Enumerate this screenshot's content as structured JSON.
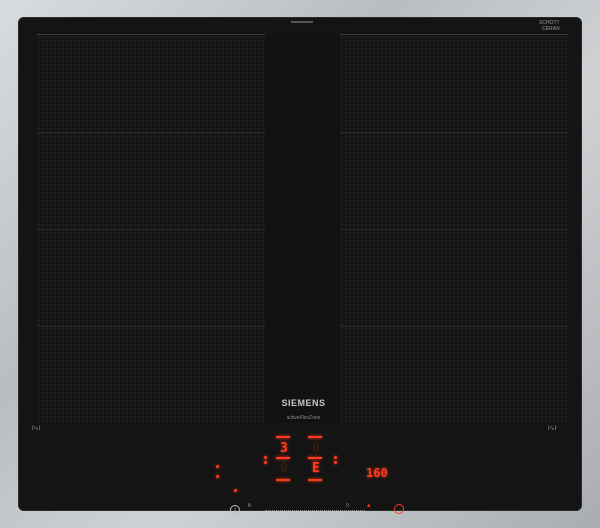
{
  "brand": "SIEMENS",
  "feature_label": "activeFlexZone",
  "glass_maker": {
    "line1": "SCHOTT",
    "line2": "CERAN"
  },
  "left_controls": "I∿I",
  "right_controls": "I∿I",
  "displays": {
    "upper_center_left": "3",
    "upper_center_right": "0",
    "lower_center_left": "0",
    "lower_center_right": "E",
    "timer": "160"
  },
  "slider": {
    "min_label": "0",
    "max_label": "9"
  },
  "colors": {
    "display": "#ff3a1e",
    "glass": "#141414",
    "frame": "#c3c6c9"
  },
  "icons": [
    "info-icon",
    "timer-icon",
    "power-icon"
  ]
}
